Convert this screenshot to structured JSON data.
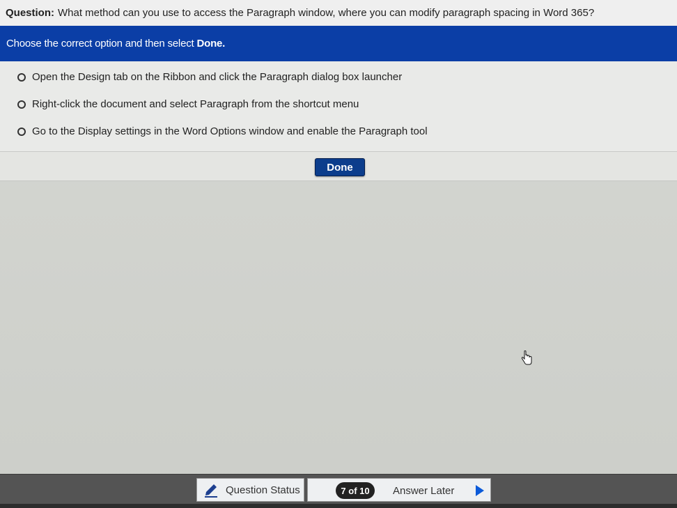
{
  "question": {
    "label": "Question:",
    "text": "What method can you use to access the Paragraph window, where you can modify paragraph spacing in Word 365?"
  },
  "instruction": {
    "text": "Choose the correct option and then select",
    "bold": "Done."
  },
  "options": [
    {
      "label": "Open the Design tab on the Ribbon and click the Paragraph dialog box launcher",
      "selected": false
    },
    {
      "label": "Right-click the document and select Paragraph from the shortcut menu",
      "selected": false
    },
    {
      "label": "Go to the Display settings in the Word Options window and enable the Paragraph tool",
      "selected": false
    }
  ],
  "done_button": {
    "label": "Done"
  },
  "footer": {
    "question_status": "Question Status",
    "progress": "7 of 10",
    "answer_later": "Answer Later",
    "icons": {
      "status": "pencil-icon",
      "next": "play-arrow-icon"
    }
  },
  "colors": {
    "instruction_bg": "#0b3ea6",
    "done_bg": "#0c3d8c",
    "footer_bg": "#545454",
    "next_arrow": "#0b5ad9"
  }
}
